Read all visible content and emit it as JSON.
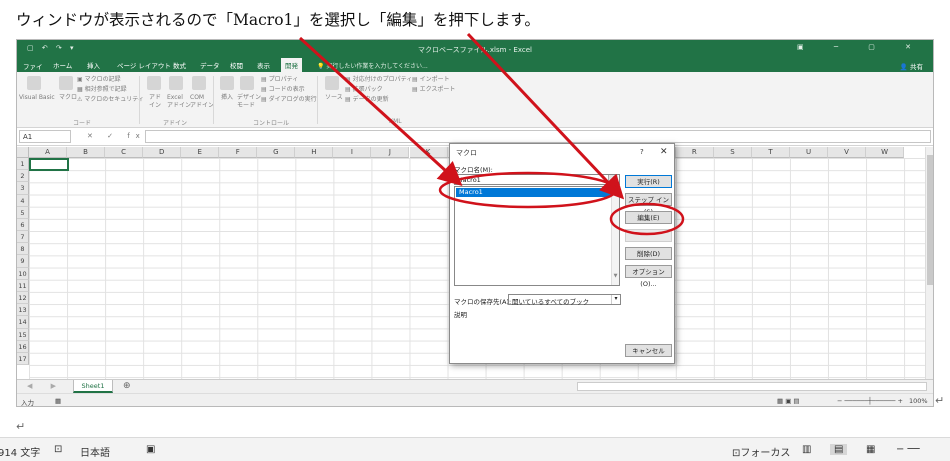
{
  "instruction": "ウィンドウが表示されるので「Macro1」を選択し「編集」を押下します。",
  "excel": {
    "title": "マクロベースファイル.xlsm - Excel",
    "tabs": [
      "ファイル",
      "ホーム",
      "挿入",
      "ページ レイアウト",
      "数式",
      "データ",
      "校閲",
      "表示",
      "開発"
    ],
    "active_tab": "開発",
    "tell_me": "実行したい作業を入力してください...",
    "share": "共有",
    "ribbon": {
      "visual_basic": "Visual Basic",
      "macro": "マクロ",
      "record": "マクロの記録",
      "relative": "相対参照で記録",
      "security": "マクロのセキュリティ",
      "group_code": "コード",
      "addin": "アド\nイン",
      "excel_addin": "Excel\nアドイン",
      "com_addin": "COM\nアドイン",
      "group_addin": "アドイン",
      "insert": "挿入",
      "design_mode": "デザイン\nモード",
      "properties": "プロパティ",
      "view_code": "コードの表示",
      "run_dialog": "ダイアログの実行",
      "group_controls": "コントロール",
      "source": "ソース",
      "map_props": "対応付けのプロパティ",
      "expansion": "拡張パック",
      "refresh": "データの更新",
      "import": "インポート",
      "export": "エクスポート",
      "group_xml": "XML"
    },
    "name_box": "A1",
    "fx": "fx",
    "columns": [
      "A",
      "B",
      "C",
      "D",
      "E",
      "F",
      "G",
      "H",
      "I",
      "J",
      "K",
      "L",
      "M",
      "N",
      "O",
      "P",
      "Q",
      "R",
      "S",
      "T",
      "U",
      "V",
      "W"
    ],
    "rows": [
      "1",
      "2",
      "3",
      "4",
      "5",
      "6",
      "7",
      "8",
      "9",
      "10",
      "11",
      "12",
      "13",
      "14",
      "15",
      "16",
      "17"
    ],
    "sheet_tab": "Sheet1",
    "status_left": "入力",
    "zoom": "100%"
  },
  "dialog": {
    "title": "マクロ",
    "help": "?",
    "close": "✕",
    "macro_name_label": "マクロ名(M):",
    "macro_name_value": "Macro1",
    "list_items": [
      "Macro1"
    ],
    "buttons": {
      "run": "実行(R)",
      "step_in": "ステップ イン(S)",
      "edit": "編集(E)",
      "create": "作成(C)",
      "delete": "削除(D)",
      "options": "オプション(O)...",
      "cancel": "キャンセル"
    },
    "location_label": "マクロの保存先(A):",
    "location_value": "開いているすべてのブック",
    "description_label": "説明"
  },
  "word_status": {
    "words": "914 文字",
    "language": "日本語",
    "focus": "フォーカス"
  },
  "annotation_color": "#d0121b"
}
